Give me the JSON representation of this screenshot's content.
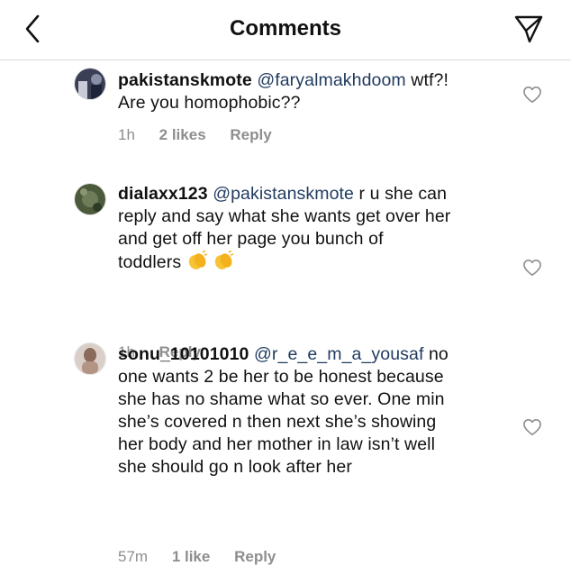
{
  "header": {
    "title": "Comments",
    "back_icon": "chevron-left-icon",
    "send_icon": "paper-plane-icon"
  },
  "comments": [
    {
      "username": "pakistanskmote",
      "mention": "@faryalmakhdoom",
      "text_after_mention": " wtf?!",
      "lines": [
        "Are you homophobic??"
      ],
      "time": "1h",
      "likes": "2 likes",
      "reply": "Reply"
    },
    {
      "username": "dialaxx123",
      "mention": "@pakistanskmote",
      "text_after_mention": " r u she can",
      "lines": [
        "reply and say what she wants get over her",
        "and get off her page you bunch of",
        "toddlers"
      ],
      "emoji": "clapping-hands-icon",
      "time": "1h",
      "likes": "",
      "reply": "Reply"
    },
    {
      "username": "sonu_10101010",
      "mention": "@r_e_e_m_a_yousaf",
      "text_after_mention": " no",
      "lines": [
        "one wants 2 be her to be honest because",
        "she has no shame what so ever. One min",
        "she’s covered n then next she’s showing",
        "her body and her mother in law isn’t well",
        "she should go n look after her"
      ],
      "time": "57m",
      "likes": "1 like",
      "reply": "Reply"
    }
  ],
  "colors": {
    "meta": "#8e8e8e",
    "mention": "#1f3a5f",
    "divider": "#dbdbdb"
  }
}
